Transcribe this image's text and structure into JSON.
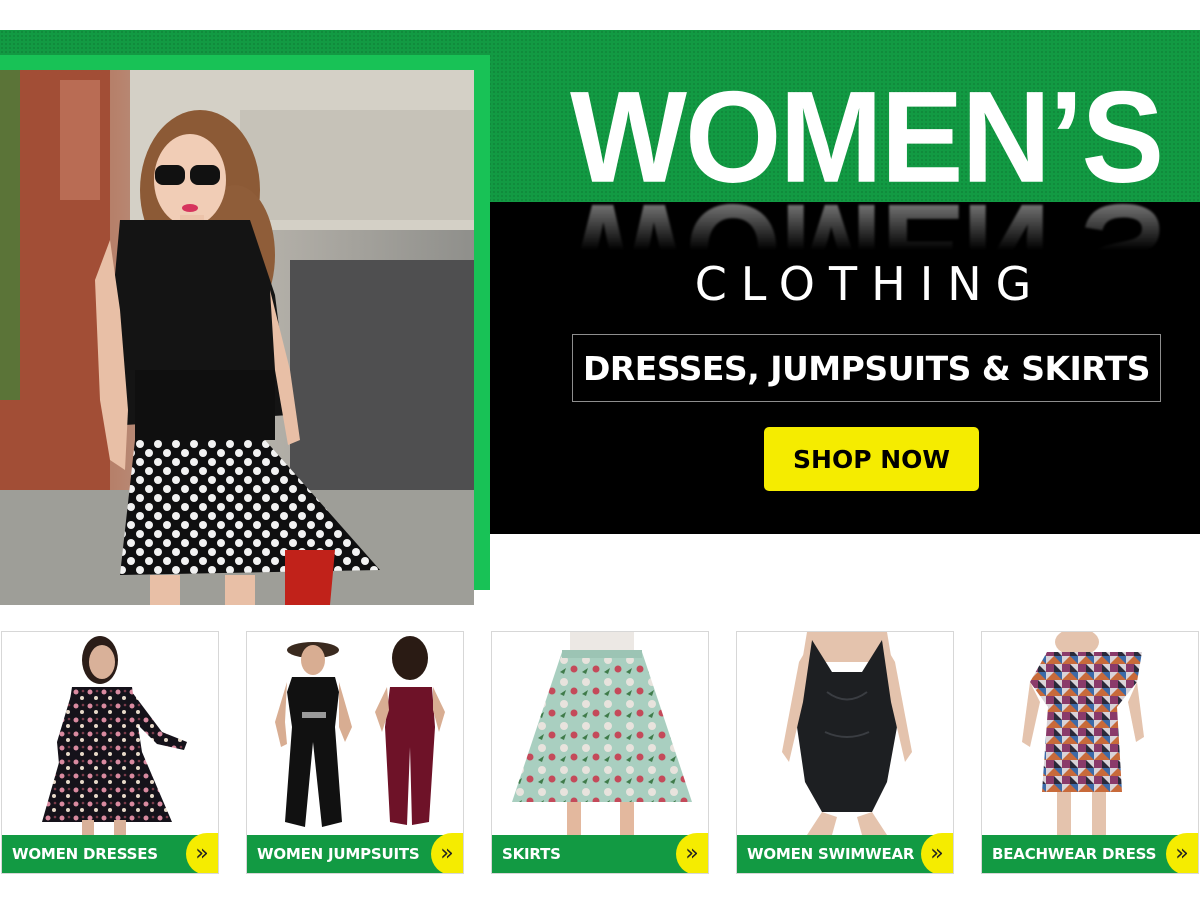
{
  "hero": {
    "title": "WOMEN’S",
    "subtitle": "CLOTHING",
    "tagline": "DRESSES, JUMPSUITS & SKIRTS",
    "cta_label": "SHOP NOW"
  },
  "categories": [
    {
      "label": "WOMEN DRESSES",
      "arrow": "»"
    },
    {
      "label": "WOMEN JUMPSUITS",
      "arrow": "»"
    },
    {
      "label": "SKIRTS",
      "arrow": "»"
    },
    {
      "label": "WOMEN SWIMWEAR",
      "arrow": "»"
    },
    {
      "label": "BEACHWEAR DRESS",
      "arrow": "»"
    }
  ],
  "colors": {
    "green": "#129a43",
    "bright_green": "#18c256",
    "yellow": "#f5ec00",
    "black": "#000000"
  }
}
